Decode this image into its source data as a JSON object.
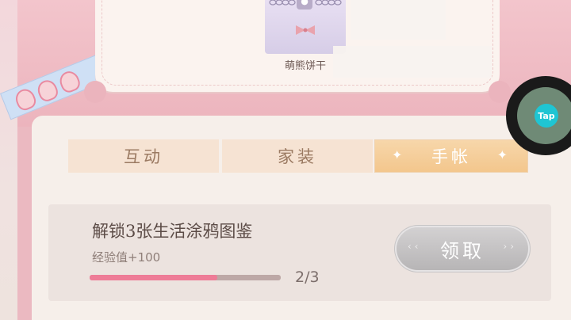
{
  "reward_item": {
    "name": "萌熊饼干",
    "icon": "lock-icon"
  },
  "tabs": [
    {
      "label": "互动",
      "active": false
    },
    {
      "label": "家装",
      "active": false
    },
    {
      "label": "手帐",
      "active": true
    }
  ],
  "task": {
    "title": "解锁3张生活涂鸦图鉴",
    "reward": "经验值+100",
    "progress_text": "2/3",
    "progress_fraction": 0.67,
    "claim_label": "领取"
  },
  "floating_button": {
    "label": "Tap"
  },
  "colors": {
    "progress_fill": "#ee7c97",
    "active_tab": "#f3c68c",
    "tap_accent": "#1fc5d3"
  }
}
